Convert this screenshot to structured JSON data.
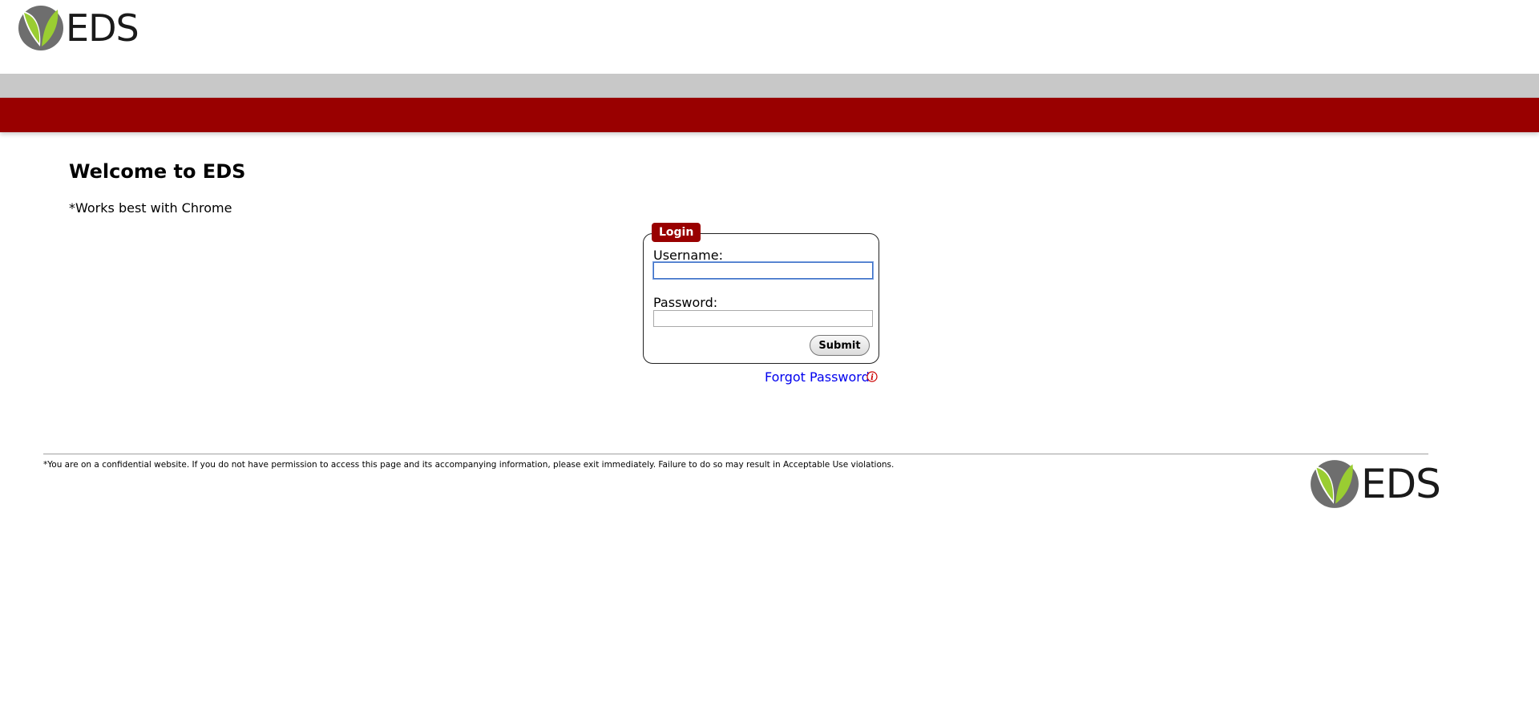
{
  "brand": {
    "logo_text": "EDS",
    "colors": {
      "primary_red": "#990000",
      "band_gray": "#c8c8c8",
      "leaf_green": "#9acd32",
      "leaf_gray": "#6e6e6e",
      "link_blue": "#0000ee"
    }
  },
  "main": {
    "heading": "Welcome to EDS",
    "note": "*Works best with Chrome"
  },
  "login": {
    "legend": "Login",
    "username_label": "Username:",
    "username_value": "",
    "password_label": "Password:",
    "password_value": "",
    "submit_label": "Submit",
    "forgot_label": "Forgot Password?",
    "info_icon": "info-icon"
  },
  "footer": {
    "disclaimer": "*You are on a confidential website. If you do not have permission to access this page and its accompanying information, please exit immediately. Failure to do so may result in Acceptable Use violations.",
    "logo_text": "EDS"
  }
}
